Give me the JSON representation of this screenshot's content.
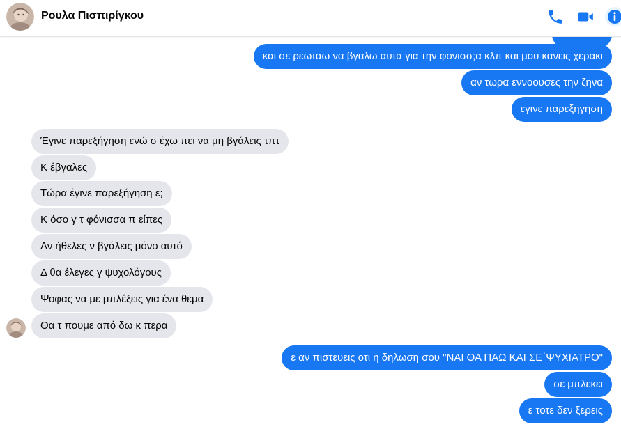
{
  "header": {
    "contact_name": "Ρουλα Πισπιρίγκου",
    "icons": [
      "phone-icon",
      "video-camera-icon",
      "info-icon"
    ],
    "accent_color": "#1877f2"
  },
  "messages": {
    "out_1": "και σε ρεωταω να βγαλω αυτα για την φονισσ;α κλπ και μου κανεις χερακι",
    "out_2": "αν τωρα εννοουσες την ζηνα",
    "out_3": "εγινε παρεξηγηση",
    "in_1": "Έγινε παρεξήγηση ενώ σ έχω πει να μη βγάλεις τπτ",
    "in_2": "Κ έβγαλες",
    "in_3": "Τώρα έγινε παρεξήγηση ε;",
    "in_4": "Κ όσο γ τ φόνισσα π είπες",
    "in_5": "Αν ήθελες ν βγάλεις μόνο αυτό",
    "in_6": "Δ θα έλεγες γ ψυχολόγους",
    "in_7": "Ψοφας να με μπλέξεις για ένα θεμα",
    "in_8": "Θα τ πουμε από δω κ περα",
    "out_4": "ε αν πιστευεις οτι η δηλωση σου \"ΝΑΙ ΘΑ ΠΑΩ ΚΑΙ ΣΕ΄ΨΥΧΙΑΤΡΟ\"",
    "out_5": "σε μπλεκει",
    "out_6": "ε τοτε δεν ξερεις"
  }
}
